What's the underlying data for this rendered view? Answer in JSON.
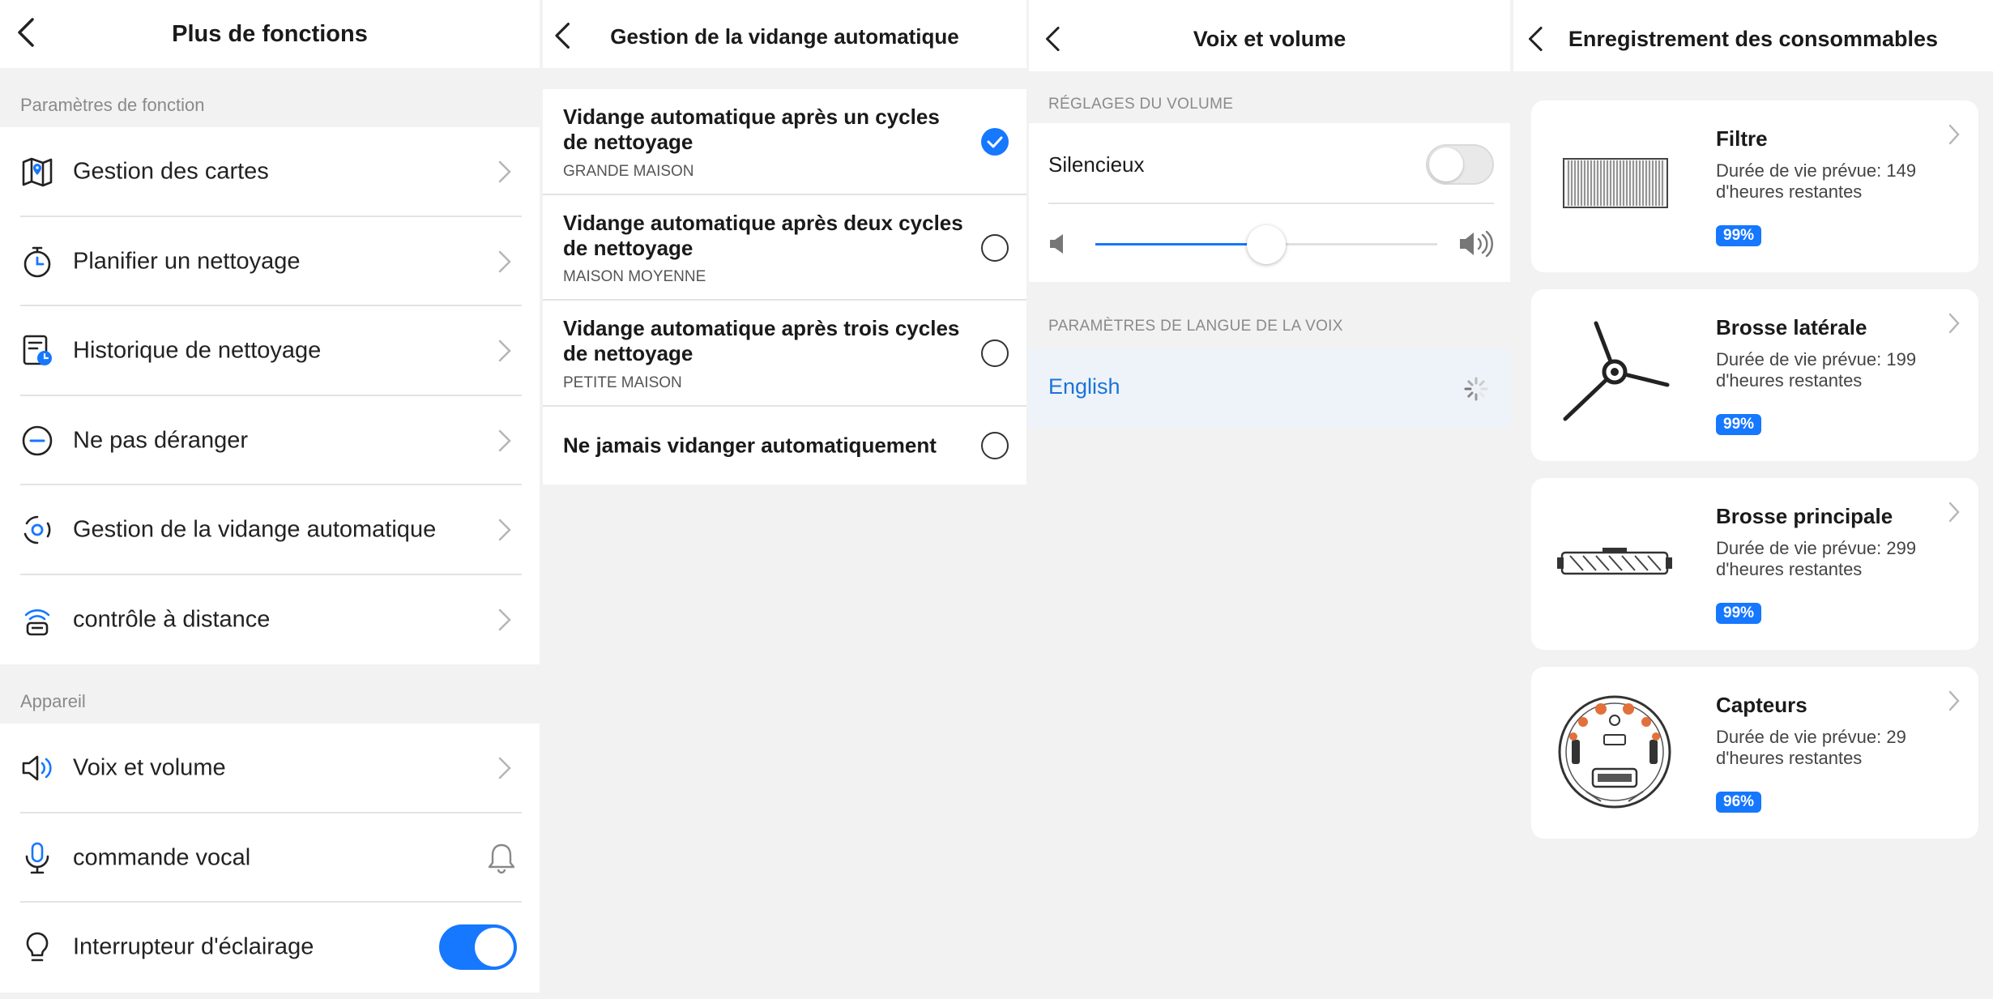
{
  "panel1": {
    "title": "Plus de fonctions",
    "section1": "Paramètres de fonction",
    "items1": [
      {
        "label": "Gestion des cartes",
        "icon": "map-icon"
      },
      {
        "label": "Planifier un nettoyage",
        "icon": "timer-icon"
      },
      {
        "label": "Historique de nettoyage",
        "icon": "history-icon"
      },
      {
        "label": "Ne pas déranger",
        "icon": "do-not-disturb-icon"
      },
      {
        "label": "Gestion de la vidange automatique",
        "icon": "auto-empty-icon"
      },
      {
        "label": "contrôle à distance",
        "icon": "remote-control-icon"
      }
    ],
    "section2": "Appareil",
    "items2": [
      {
        "label": "Voix et volume",
        "icon": "speaker-icon"
      },
      {
        "label": "commande vocal",
        "icon": "microphone-icon"
      },
      {
        "label": "Interrupteur d'éclairage",
        "icon": "bulb-icon",
        "toggle_on": true
      }
    ]
  },
  "panel2": {
    "title": "Gestion de la vidange automatique",
    "options": [
      {
        "title": "Vidange automatique après un cycles de nettoyage",
        "subtitle": "GRANDE MAISON",
        "checked": true
      },
      {
        "title": "Vidange automatique après deux cycles de nettoyage",
        "subtitle": "MAISON MOYENNE",
        "checked": false
      },
      {
        "title": "Vidange automatique après trois cycles de nettoyage",
        "subtitle": "PETITE MAISON",
        "checked": false
      },
      {
        "title": "Ne jamais vidanger automatiquement",
        "subtitle": "",
        "checked": false
      }
    ]
  },
  "panel3": {
    "title": "Voix et volume",
    "volume_section": "RÉGLAGES DU VOLUME",
    "silent_label": "Silencieux",
    "silent_on": false,
    "volume_level": 0.5,
    "language_section": "PARAMÈTRES DE LANGUE DE LA VOIX",
    "language": "English"
  },
  "panel4": {
    "title": "Enregistrement des consommables",
    "cards": [
      {
        "name": "Filtre",
        "desc": "Durée de vie prévue: 149 d'heures restantes",
        "percent": "99%",
        "image": "filter-image"
      },
      {
        "name": "Brosse latérale",
        "desc": "Durée de vie prévue: 199 d'heures restantes",
        "percent": "99%",
        "image": "side-brush-image"
      },
      {
        "name": "Brosse principale",
        "desc": "Durée de vie prévue: 299 d'heures restantes",
        "percent": "99%",
        "image": "main-brush-image"
      },
      {
        "name": "Capteurs",
        "desc": "Durée de vie prévue: 29 d'heures restantes",
        "percent": "96%",
        "image": "sensors-image"
      }
    ]
  },
  "colors": {
    "accent": "#1677ff",
    "sensor_highlight": "#e2703a"
  }
}
